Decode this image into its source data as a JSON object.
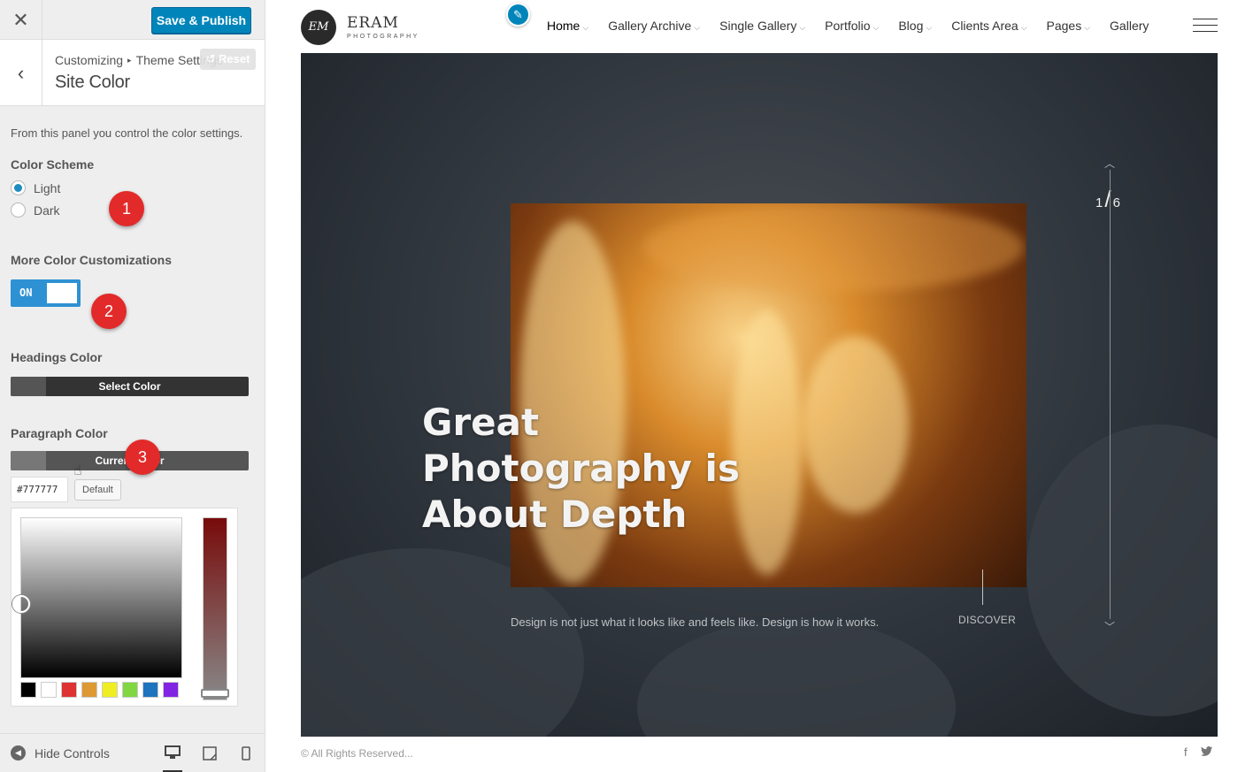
{
  "customizer": {
    "close_icon_glyph": "✕",
    "publish_label": "Save & Publish",
    "breadcrumb": {
      "root": "Customizing",
      "separator": "▸",
      "section": "Theme Settings"
    },
    "section_title": "Site Color",
    "reset_label": "Reset",
    "description": "From this panel you control the color settings.",
    "color_scheme": {
      "label": "Color Scheme",
      "options": [
        {
          "label": "Light",
          "selected": true
        },
        {
          "label": "Dark",
          "selected": false
        }
      ]
    },
    "more_custom": {
      "label": "More Color Customizations",
      "toggle_text": "ON",
      "toggle_on": true
    },
    "headings_color": {
      "label": "Headings Color",
      "button": "Select Color",
      "swatch": "#555555"
    },
    "paragraph_color": {
      "label": "Paragraph Color",
      "button": "Current Color",
      "hex_value": "#777777",
      "default_label": "Default",
      "palette": [
        "#000000",
        "#ffffff",
        "#dd3333",
        "#dd9933",
        "#eeee22",
        "#81d742",
        "#1e73be",
        "#8224e3"
      ]
    },
    "badges": [
      "1",
      "2",
      "3"
    ],
    "hide_controls_label": "Hide Controls",
    "devices": [
      "desktop-icon",
      "tablet-icon",
      "mobile-icon"
    ]
  },
  "site": {
    "logo_initials": "EM",
    "logo_name": "ERAM",
    "logo_sub": "PHOTOGRAPHY",
    "nav": [
      {
        "label": "Home",
        "dropdown": true
      },
      {
        "label": "Gallery Archive",
        "dropdown": true
      },
      {
        "label": "Single Gallery",
        "dropdown": true
      },
      {
        "label": "Portfolio",
        "dropdown": true
      },
      {
        "label": "Blog",
        "dropdown": true
      },
      {
        "label": "Clients Area",
        "dropdown": true
      },
      {
        "label": "Pages",
        "dropdown": true
      },
      {
        "label": "Gallery",
        "dropdown": false
      }
    ],
    "hero": {
      "headline_1": "Great",
      "headline_2": "Photography is",
      "headline_3": "About Depth",
      "description": "Design is not just what it looks like and feels like. Design is how it works.",
      "discover": "DISCOVER",
      "slide_current": "1",
      "slide_total": "6"
    },
    "footer_text": "© All Rights Reserved...",
    "social": [
      "f",
      "t"
    ]
  },
  "colors": {
    "accent": "#0085ba",
    "toggle": "#2e91d3",
    "badge": "#e22a2a"
  }
}
